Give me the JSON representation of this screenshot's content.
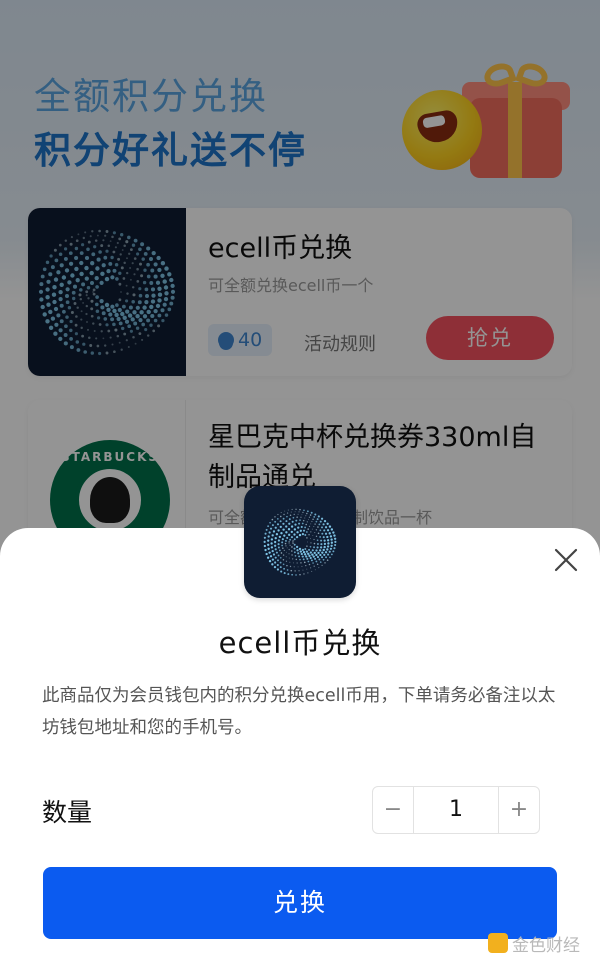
{
  "hero": {
    "title_line1": "全额积分兑换",
    "title_line2": "积分好礼送不停"
  },
  "products": [
    {
      "title": "ecell币兑换",
      "description": "可全额兑换ecell币一个",
      "points": "40",
      "rule_link": "活动规则",
      "grab_label": "抢兑"
    },
    {
      "title": "星巴克中杯兑换券330ml自制品通兑",
      "description": "可全额兑换星巴克自制饮品一杯",
      "logo_text": "STARBUCKS"
    }
  ],
  "sheet": {
    "title": "ecell币兑换",
    "note": "此商品仅为会员钱包内的积分兑换ecell币用，下单请务必备注以太坊钱包地址和您的手机号。",
    "quantity_label": "数量",
    "quantity_value": "1",
    "minus_label": "−",
    "plus_label": "+",
    "submit_label": "兑换"
  },
  "watermark": "金色财经",
  "colors": {
    "accent_blue": "#0b5bf0",
    "grab_red": "#f5515f",
    "hero_blue": "#1e74c8",
    "dark_navy": "#0f1d33"
  },
  "icons": [
    "gift-icon",
    "coin-icon",
    "spiral-logo-icon",
    "starbucks-logo-icon",
    "close-icon"
  ]
}
